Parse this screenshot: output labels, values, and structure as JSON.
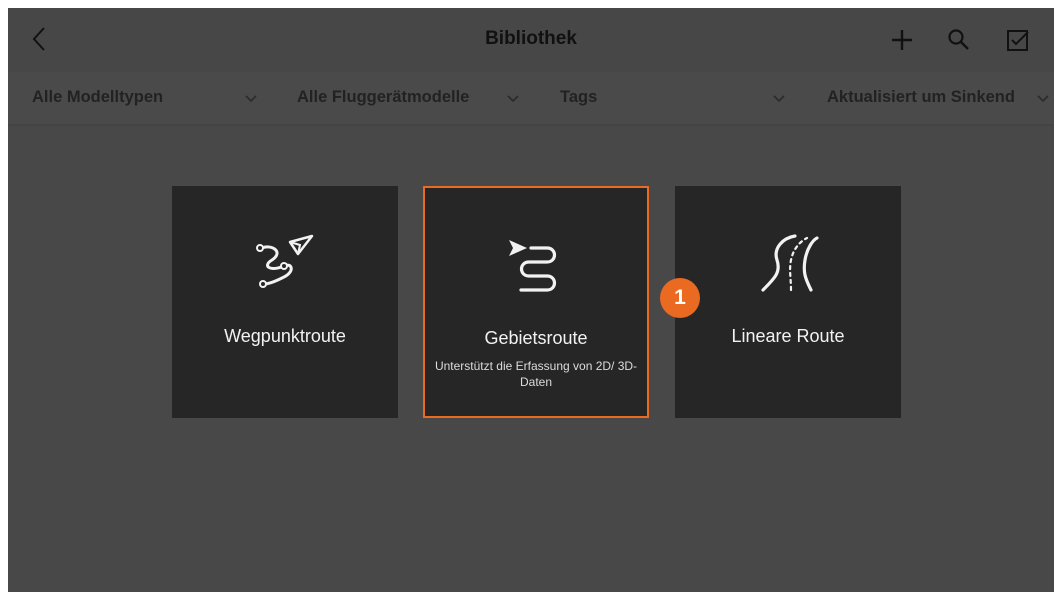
{
  "header": {
    "title": "Bibliothek",
    "back_icon": "chevron-left-icon",
    "actions": [
      {
        "name": "add",
        "icon": "plus-icon"
      },
      {
        "name": "search",
        "icon": "search-icon"
      },
      {
        "name": "select",
        "icon": "checkbox-icon"
      }
    ]
  },
  "filters": {
    "model_types": "Alle Modelltypen",
    "aircraft_models": "Alle Fluggerätmodelle",
    "tags": "Tags",
    "sort": "Aktualisiert um Sinkend"
  },
  "route_types": [
    {
      "label": "Wegpunktroute",
      "description": "",
      "icon": "waypoint-route-icon",
      "selected": false
    },
    {
      "label": "Gebietsroute",
      "description": "Unterstützt die Erfassung von 2D/ 3D-Daten",
      "icon": "area-route-icon",
      "selected": true
    },
    {
      "label": "Lineare Route",
      "description": "",
      "icon": "linear-route-icon",
      "selected": false
    }
  ],
  "annotation_marker": "1",
  "colors": {
    "accent": "#ea6a22",
    "card_background": "#262626",
    "screen_background": "#4a4a4a"
  }
}
